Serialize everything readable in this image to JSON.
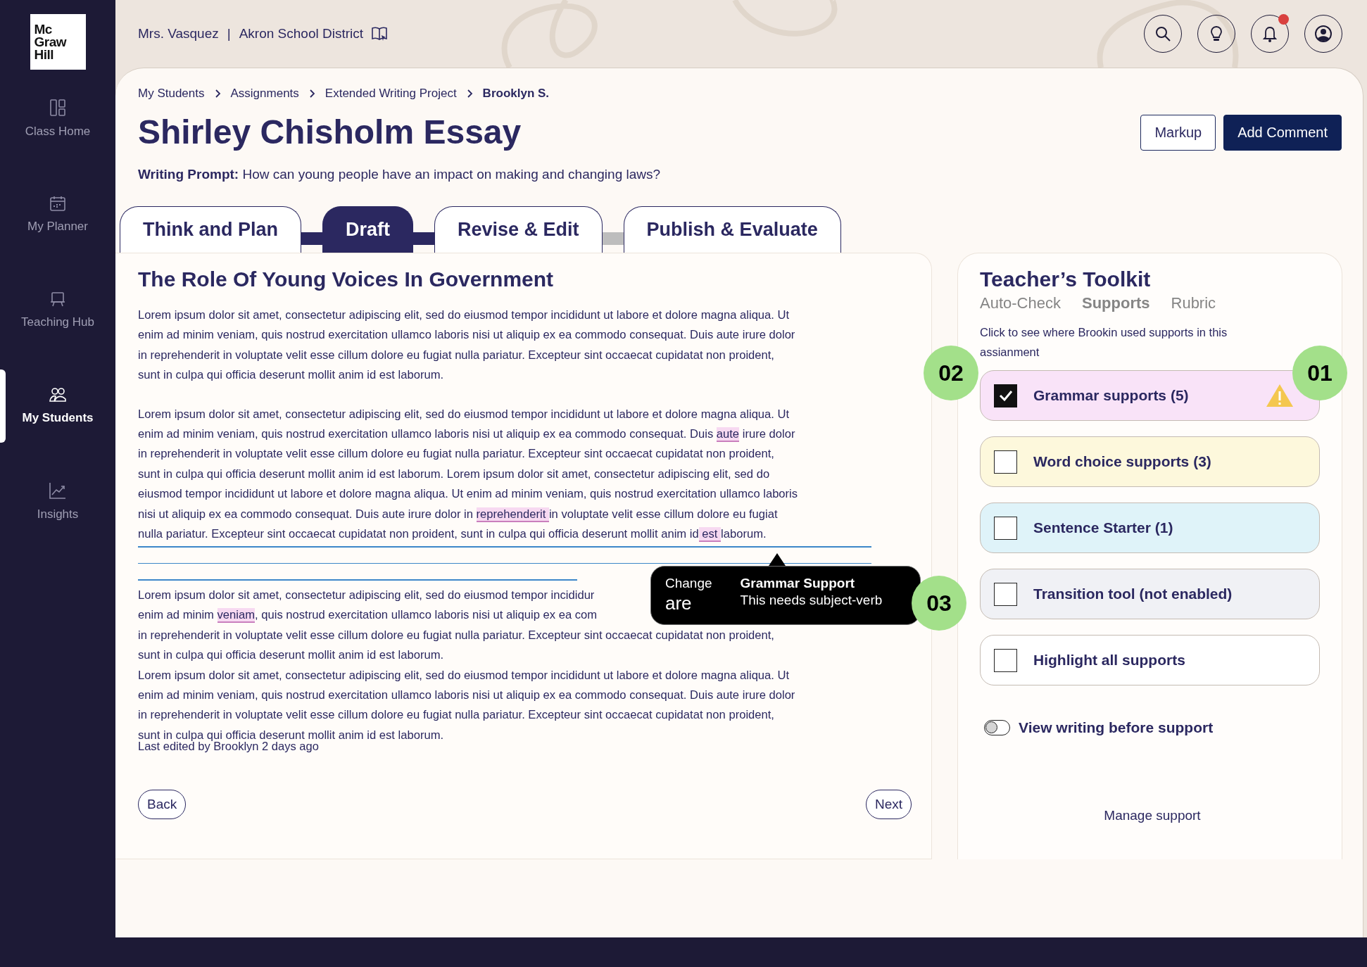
{
  "sidebar": {
    "logo": [
      "Mc",
      "Graw",
      "Hill"
    ],
    "items": [
      {
        "label": "Class Home",
        "selected": false
      },
      {
        "label": "My Planner",
        "selected": false
      },
      {
        "label": "Teaching Hub",
        "selected": false
      },
      {
        "label": "My Students",
        "selected": true
      },
      {
        "label": "Insights",
        "selected": false
      }
    ]
  },
  "header": {
    "teacher": "Mrs. Vasquez",
    "separator": "|",
    "district": "Akron School District",
    "buttons": [
      {
        "notification": false
      },
      {
        "notification": false
      },
      {
        "notification": true
      },
      {
        "notification": false
      }
    ]
  },
  "breadcrumb": [
    "My Students",
    "Assignments",
    "Extended Writing Project",
    "Brooklyn S."
  ],
  "title": "Shirley Chisholm Essay",
  "actions": [
    {
      "label": "Markup",
      "kind": "secondary"
    },
    {
      "label": "Add Comment",
      "kind": "primary"
    }
  ],
  "prompt": "**Writing Prompt:** How can young people have an impact on making and changing laws?",
  "stages": [
    {
      "label": "Think and Plan",
      "selected": false
    },
    {
      "label": "Draft",
      "selected": true
    },
    {
      "label": "Revise & Edit",
      "selected": false
    },
    {
      "label": "Publish & Evaluate",
      "selected": false
    }
  ],
  "essay": {
    "title": "The Role Of Young Voices In Government",
    "blocks": [
      {
        "kind": "paragraph",
        "lines": [
          "Lorem ipsum dolor sit amet, consectetur adipiscing elit, sed do eiusmod tempor incididunt ut labore et dolore magna aliqua. Ut",
          "enim ad minim veniam, quis nostrud exercitation ullamco laboris nisi ut aliquip ex ea commodo consequat. Duis aute irure dolor",
          "in reprehenderit in voluptate velit esse cillum dolore eu fugiat nulla pariatur. Excepteur sint occaecat cupidatat non proident,",
          "sunt in culpa qui officia deserunt mollit anim id est laborum."
        ]
      },
      {
        "kind": "paragraph",
        "lines": [
          " Lorem ipsum dolor sit amet, consectetur adipiscing elit, sed do eiusmod tempor incididunt ut labore et dolore magna aliqua. Ut",
          [
            {
              "text": "enim ad minim veniam, quis nostrud exercitation ullamco laboris nisi ut aliquip ex ea commodo consequat. Duis ",
              "highlighted": false
            },
            {
              "text": "aute",
              "highlighted": true
            },
            {
              "text": " irure dolor",
              "highlighted": false
            }
          ],
          "in reprehenderit in voluptate velit esse cillum dolore eu fugiat nulla pariatur. Excepteur sint occaecat cupidatat non proident,",
          "sunt in culpa qui officia deserunt mollit anim id est laborum. Lorem ipsum dolor sit amet, consectetur adipiscing elit, sed do",
          "eiusmod tempor incididunt ut labore et dolore magna aliqua. Ut enim ad minim veniam, quis nostrud exercitation ullamco laboris",
          [
            {
              "text": "nisi ut aliquip ex ea commodo consequat. Duis aute irure dolor in ",
              "highlighted": false
            },
            {
              "text": "reprehenderit ",
              "highlighted": true
            },
            {
              "text": "in voluptate velit esse cillum dolore eu fugiat",
              "highlighted": false
            }
          ],
          [
            {
              "text": "nulla pariatur. Excepteur sint occaecat cupidatat non proident, sunt in culpa qui officia deserunt mollit anim id",
              "highlighted": false
            },
            {
              "text": " est ",
              "highlighted": true
            },
            {
              "text": "laborum.",
              "highlighted": false
            }
          ]
        ]
      },
      {
        "kind": "rules"
      },
      {
        "kind": "paragraph",
        "lines": [
          "Lorem ipsum dolor sit amet, consectetur adipiscing elit, sed do eiusmod tempor incididur",
          [
            {
              "text": "enim ad minim ",
              "highlighted": false
            },
            {
              "text": "veniam",
              "highlighted": true
            },
            {
              "text": ", quis nostrud exercitation ullamco laboris nisi ut aliquip ex ea com",
              "highlighted": false
            }
          ],
          "in reprehenderit in voluptate velit esse cillum dolore eu fugiat nulla pariatur. Excepteur sint occaecat cupidatat non proident,",
          "sunt in culpa qui officia deserunt mollit anim id est laborum.",
          "Lorem ipsum dolor sit amet, consectetur adipiscing elit, sed do eiusmod tempor incididunt ut labore et dolore magna aliqua. Ut",
          "enim ad minim veniam, quis nostrud exercitation ullamco laboris nisi ut aliquip ex ea commodo consequat. Duis aute irure dolor",
          "in reprehenderit in voluptate velit esse cillum dolore eu fugiat nulla pariatur. Excepteur sint occaecat cupidatat non proident,",
          "sunt in culpa qui officia deserunt mollit anim id est laborum."
        ]
      }
    ],
    "last_edited": "Last edited by Brooklyn 2 days ago",
    "tooltip": {
      "label": "Change",
      "suggestion": "are",
      "title": "Grammar Support",
      "message": "This needs subject-verb"
    },
    "nav": [
      "Back",
      "Next"
    ]
  },
  "toolkit": {
    "title": "Teacher’s Toolkit",
    "tabs": [
      {
        "label": "Auto-Check",
        "selected": false
      },
      {
        "label": "Supports",
        "selected": true
      },
      {
        "label": "Rubric",
        "selected": false
      }
    ],
    "instruction": "Click to see where Brookin used supports in this assianment",
    "supports": [
      {
        "label": "Grammar supports (5)",
        "checked": true,
        "warning": true,
        "color": "#f9e3f8"
      },
      {
        "label": "Word choice supports (3)",
        "checked": false,
        "warning": false,
        "color": "#fdf8dc"
      },
      {
        "label": "Sentence Starter (1)",
        "checked": false,
        "warning": false,
        "color": "#dff3f9"
      },
      {
        "label": "Transition tool (not enabled)",
        "checked": false,
        "warning": false,
        "color": "#f0f1f5"
      },
      {
        "label": "Highlight all supports",
        "checked": false,
        "warning": false,
        "color": "#ffffff"
      }
    ],
    "toggle": {
      "label": "View writing before support",
      "on": false
    },
    "link": "Manage support"
  },
  "callouts": [
    "01",
    "02",
    "03"
  ]
}
